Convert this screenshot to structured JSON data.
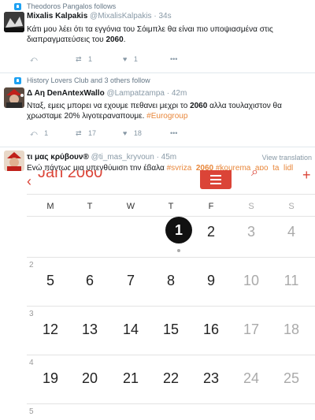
{
  "tweet1": {
    "context": "Theodoros Pangalos follows",
    "name": "Mixalis Kalpakis",
    "handle": "@MixalisKalpakis",
    "time": "· 34s",
    "text_pre": "Κάτι μου λέει ότι τα εγγόνια του Σόιμπλε θα είναι πιο υποψιασμένα στις διαπραγματεύσεις του ",
    "text_bold": "2060",
    "text_post": ".",
    "retweets": "1",
    "likes": "1"
  },
  "tweet2": {
    "context": "History Lovers Club and 3 others follow",
    "name": "Δ Αη DenAntexWallo",
    "handle": "@Lampatzampa",
    "time": "· 42m",
    "text_pre": "Νταξ, εμεις μπορει να εχουμε πεθανει μεχρι το ",
    "text_bold": "2060",
    "text_post": " αλλα τουλαχιστον θα χρωσταμε 20% λιγοτεραναπουμε. ",
    "hashtag": "#Eurogroup",
    "replies": "1",
    "retweets": "17",
    "likes": "18"
  },
  "tweet3": {
    "name": "τι μας κρύβουν®",
    "handle": "@ti_mas_kryvoun",
    "time": "· 45m",
    "view_translation": "View translation",
    "text": "Εγώ πάντως μια υπενθύμιση την έβαλα ",
    "tag1": "#syriza_",
    "tag1_bold": "2060",
    "tag2": " #kourema_apo_ta_lidl"
  },
  "calendar": {
    "month_label": "Jan 2060",
    "weekdays": [
      "M",
      "T",
      "W",
      "T",
      "F",
      "S",
      "S"
    ],
    "week_numbers": [
      "2",
      "3",
      "4",
      "5"
    ],
    "weeks": [
      [
        "",
        "",
        "",
        "1",
        "2",
        "3",
        "4"
      ],
      [
        "5",
        "6",
        "7",
        "8",
        "9",
        "10",
        "11"
      ],
      [
        "12",
        "13",
        "14",
        "15",
        "16",
        "17",
        "18"
      ],
      [
        "19",
        "20",
        "21",
        "22",
        "23",
        "24",
        "25"
      ]
    ],
    "today": "1",
    "accent": "#db4437"
  },
  "colors": {
    "link": "#1da1f2",
    "hashtag": "#e8873b"
  }
}
